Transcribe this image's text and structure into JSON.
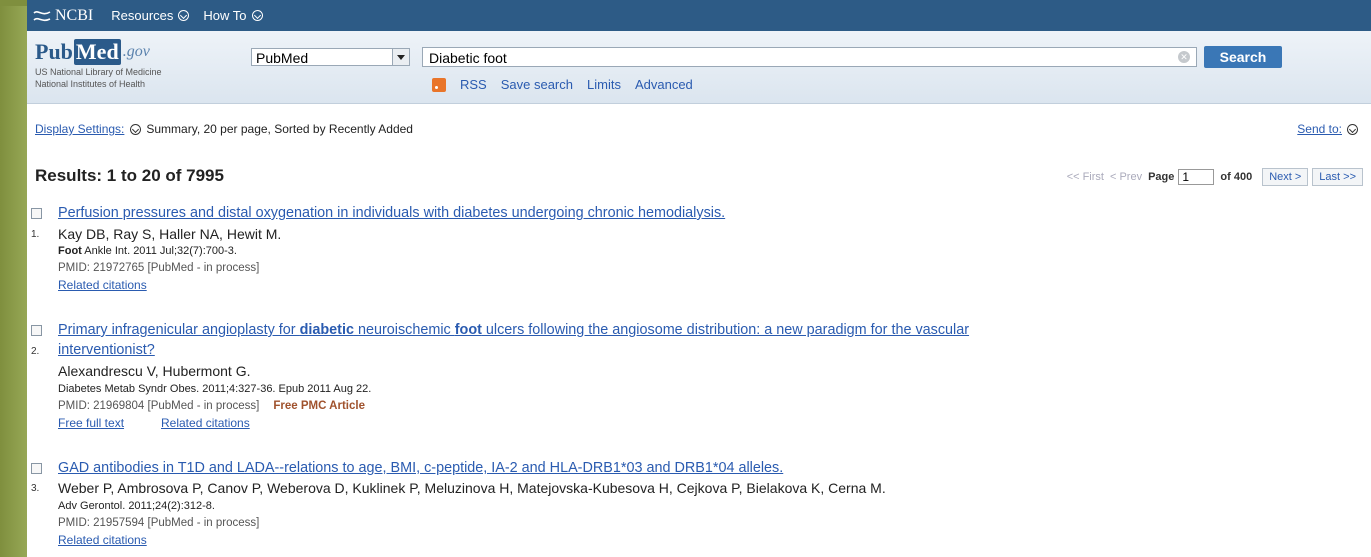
{
  "ncbi_bar": {
    "logo": "NCBI",
    "menus": [
      "Resources",
      "How To"
    ]
  },
  "header": {
    "logo_pub": "Pub",
    "logo_med": "Med",
    "logo_gov": ".gov",
    "org_line1": "US National Library of Medicine",
    "org_line2": "National Institutes of Health",
    "database": "PubMed",
    "search_value": "Diabetic foot",
    "search_button": "Search",
    "links": [
      "RSS",
      "Save search",
      "Limits",
      "Advanced"
    ]
  },
  "display": {
    "settings_label": "Display Settings:",
    "settings_value": "Summary, 20 per page, Sorted by Recently Added",
    "send_to": "Send to:"
  },
  "results": {
    "title": "Results: 1 to 20 of 7995",
    "pager": {
      "first": "<< First",
      "prev": "< Prev",
      "page_label": "Page",
      "page_value": "1",
      "of_label": "of 400",
      "next": "Next >",
      "last": "Last >>"
    },
    "items": [
      {
        "num": "1.",
        "title": "Perfusion pressures and distal oxygenation in individuals with diabetes undergoing chronic hemodialysis.",
        "authors": "Kay DB, Ray S, Haller NA, Hewit M.",
        "journal_bold": "Foot",
        "journal": " Ankle Int. 2011 Jul;32(7):700-3.",
        "pmid": "PMID: 21972765 [PubMed - in process]",
        "links": [
          "Related citations"
        ]
      },
      {
        "num": "2.",
        "title_parts": [
          "Primary infragenicular angioplasty for ",
          "diabetic",
          " neuroischemic ",
          "foot",
          " ulcers following the angiosome distribution: a new paradigm for the vascular"
        ],
        "title_line2": "interventionist?",
        "authors": "Alexandrescu V, Hubermont G.",
        "journal": "Diabetes Metab Syndr Obes. 2011;4:327-36. Epub 2011 Aug 22.",
        "pmid": "PMID: 21969804 [PubMed - in process]",
        "pmc": "Free PMC Article",
        "links": [
          "Free full text",
          "Related citations"
        ]
      },
      {
        "num": "3.",
        "title": "GAD antibodies in T1D and LADA--relations to age, BMI, c-peptide, IA-2 and HLA-DRB1*03 and DRB1*04 alleles.",
        "authors": "Weber P, Ambrosova P, Canov P, Weberova D, Kuklinek P, Meluzinova H, Matejovska-Kubesova H, Cejkova P, Bielakova K, Cerna M.",
        "journal": "Adv Gerontol. 2011;24(2):312-8.",
        "pmid": "PMID: 21957594 [PubMed - in process]",
        "links": [
          "Related citations"
        ]
      }
    ]
  },
  "colors": {
    "ncbi_bar": "#2d5b86",
    "link": "#2a5bb0",
    "search_button": "#3a77b6",
    "pmc": "#a0522d",
    "backdrop": "#8a9a4a"
  }
}
